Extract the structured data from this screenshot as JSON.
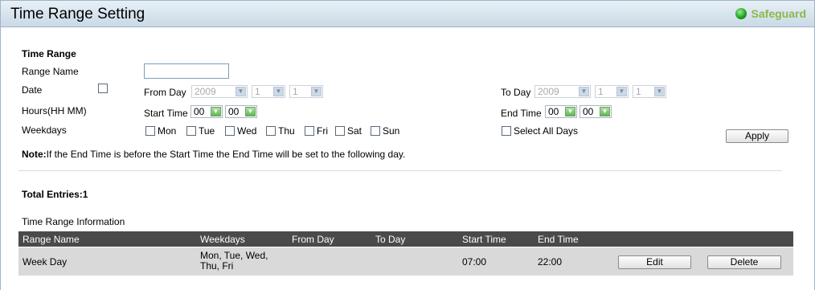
{
  "header": {
    "title": "Time Range Setting",
    "safeguard_label": "Safeguard"
  },
  "form": {
    "section_title": "Time Range",
    "range_name_label": "Range Name",
    "range_name_value": "",
    "date_label": "Date",
    "from_day_label": "From Day",
    "from_year": "2009",
    "from_month": "1",
    "from_day": "1",
    "to_day_label": "To Day",
    "to_year": "2009",
    "to_month": "1",
    "to_day": "1",
    "hours_label": "Hours(HH MM)",
    "start_time_label": "Start Time",
    "start_hh": "00",
    "start_mm": "00",
    "end_time_label": "End Time",
    "end_hh": "00",
    "end_mm": "00",
    "weekdays_label": "Weekdays",
    "days": [
      "Mon",
      "Tue",
      "Wed",
      "Thu",
      "Fri",
      "Sat",
      "Sun"
    ],
    "select_all_label": "Select All Days",
    "apply_label": "Apply",
    "note_bold": "Note:",
    "note_text": "If the End Time is before the Start Time the End Time will be set to the following day."
  },
  "summary": {
    "total_entries": "Total Entries:1"
  },
  "table": {
    "caption": "Time Range Information",
    "columns": [
      "Range Name",
      "Weekdays",
      "From Day",
      "To Day",
      "Start Time",
      "End Time"
    ],
    "rows": [
      {
        "range_name": "Week Day",
        "weekdays_line1": "Mon, Tue, Wed,",
        "weekdays_line2": "Thu, Fri",
        "from_day": "",
        "to_day": "",
        "start_time": "07:00",
        "end_time": "22:00",
        "edit_label": "Edit",
        "delete_label": "Delete"
      }
    ]
  }
}
